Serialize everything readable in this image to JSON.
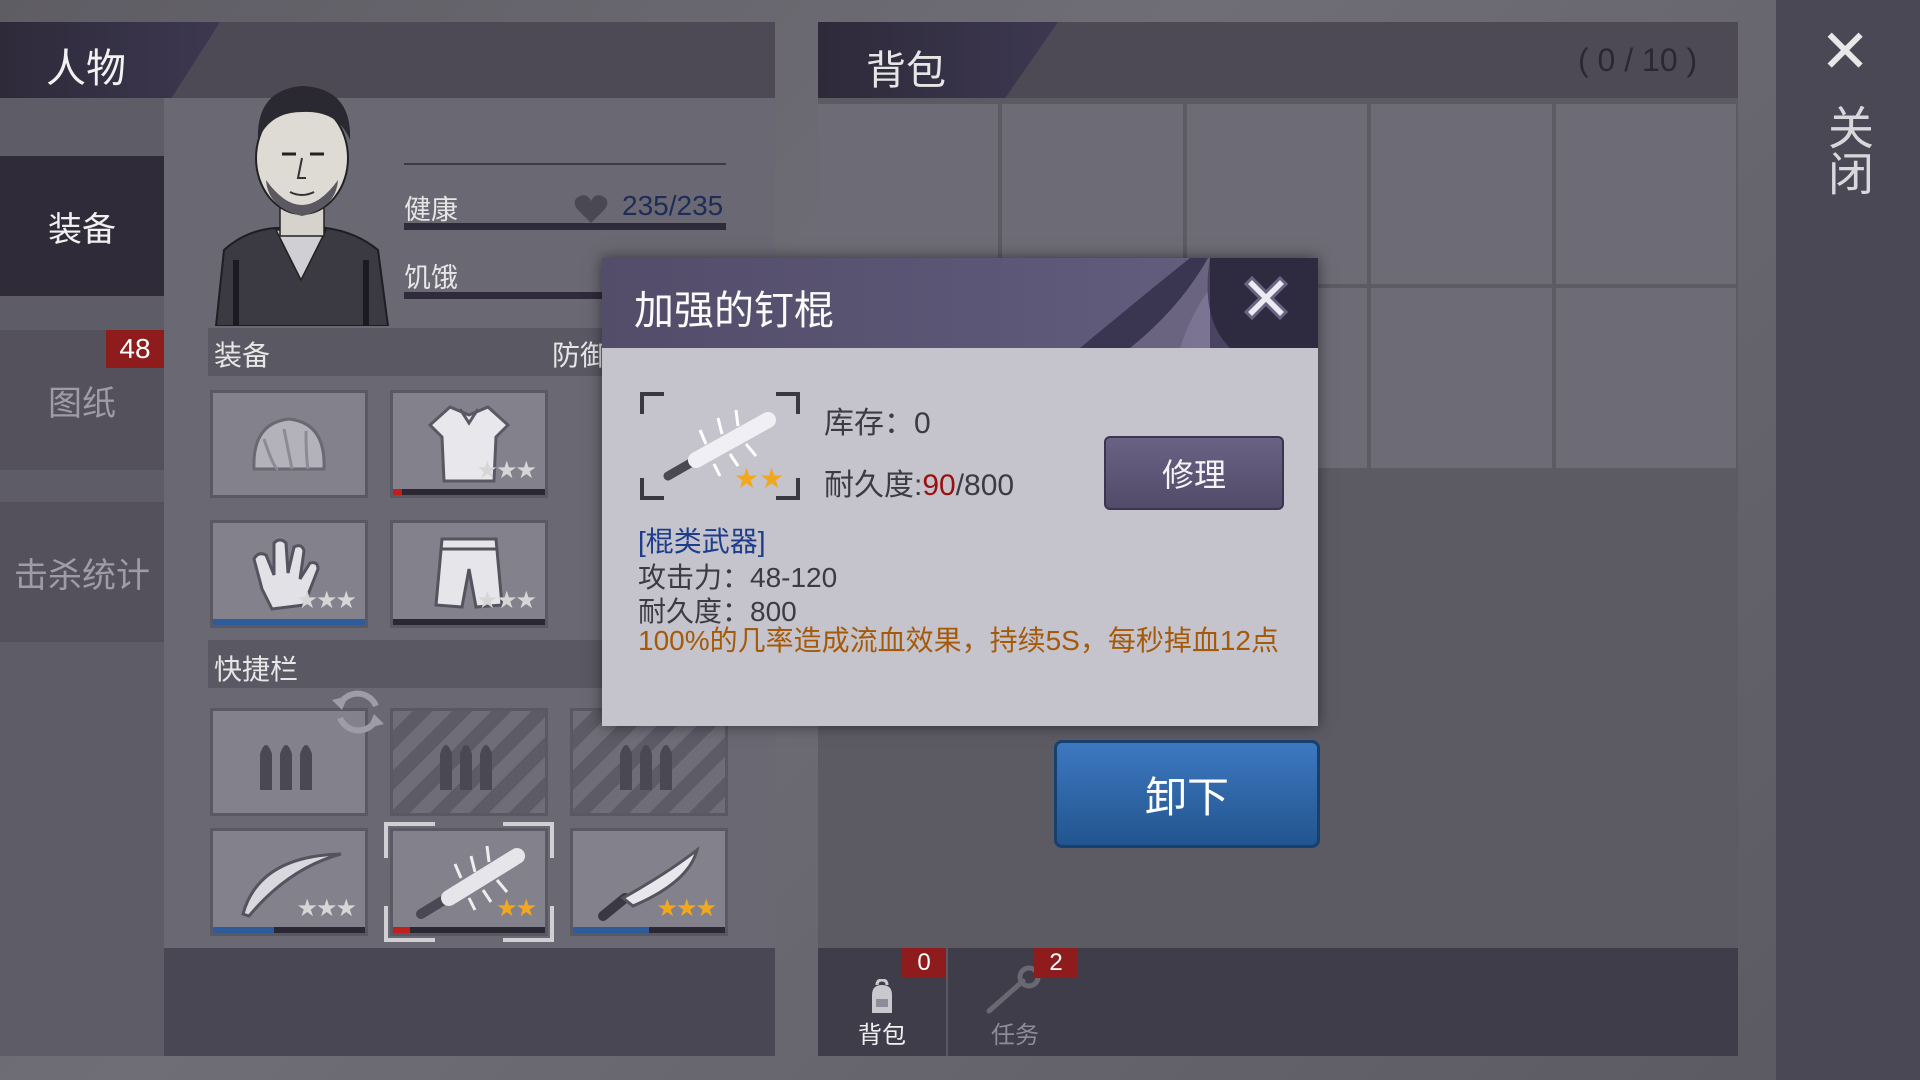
{
  "character": {
    "title": "人物",
    "tabs": [
      {
        "label": "装备"
      },
      {
        "label": "图纸",
        "badge": "48"
      },
      {
        "label": "击杀统计"
      }
    ],
    "stats": {
      "health_label": "健康",
      "health_value": "235/235",
      "hunger_label": "饥饿"
    },
    "sections": {
      "equipment": "装备",
      "defense": "防御",
      "quickbar": "快捷栏"
    }
  },
  "backpack": {
    "title": "背包",
    "count": "( 0 / 10 )",
    "footer_tabs": [
      {
        "label": "背包",
        "badge": "0"
      },
      {
        "label": "任务",
        "badge": "2"
      }
    ]
  },
  "close": {
    "label": "关闭"
  },
  "popup": {
    "title": "加强的钉棍",
    "stock": "库存：0",
    "durability_prefix": "耐久度:",
    "durability_current": "90",
    "durability_max": "/800",
    "repair_label": "修理",
    "type": "[棍类武器]",
    "attack": "攻击力：48-120",
    "durability_stat": "耐久度：800",
    "effect": "100%的几率造成流血效果，持续5S，每秒掉血12点",
    "stars": 2
  },
  "unequip_label": "卸下",
  "equipment_slots": [
    {
      "item": "hat",
      "stars": 0
    },
    {
      "item": "shirt",
      "stars": 3
    },
    {
      "item": "gloves",
      "stars": 3
    },
    {
      "item": "pants",
      "stars": 3
    }
  ],
  "quick_slots": [
    {
      "item": "ammo",
      "stars": 0
    },
    {
      "item": "ammo-locked",
      "stars": 0
    },
    {
      "item": "ammo-locked",
      "stars": 0
    },
    {
      "item": "bow",
      "stars": 3
    },
    {
      "item": "nail-bat",
      "stars": 2
    },
    {
      "item": "machete",
      "stars": 3
    }
  ],
  "colors": {
    "accent_purple": "#534d6a",
    "button_blue": "#2f66a8",
    "badge_red": "#8e1c1c",
    "star_gold": "#f2a81c",
    "effect_orange": "#a55a0a",
    "type_blue": "#1d3d8c"
  }
}
